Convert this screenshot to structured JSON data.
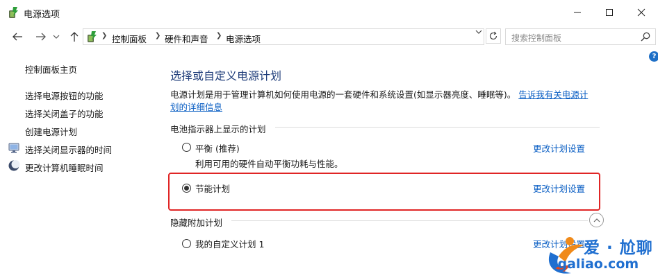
{
  "window": {
    "title": "电源选项",
    "min_icon": "minimize-icon",
    "max_icon": "maximize-icon",
    "close_icon": "close-icon"
  },
  "address_bar": {
    "breadcrumbs": [
      "控制面板",
      "硬件和声音",
      "电源选项"
    ],
    "search_placeholder": "搜索控制面板"
  },
  "sidebar": {
    "items": [
      {
        "label": "控制面板主页"
      },
      {
        "label": "选择电源按钮的功能"
      },
      {
        "label": "选择关闭盖子的功能"
      },
      {
        "label": "创建电源计划"
      },
      {
        "label": "选择关闭显示器的时间",
        "icon": "monitor-power-icon"
      },
      {
        "label": "更改计算机睡眠时间",
        "icon": "moon-sleep-icon"
      }
    ]
  },
  "main": {
    "title": "选择或自定义电源计划",
    "description": "电源计划是用于管理计算机如何使用电源的一套硬件和系统设置(如显示器亮度、睡眠等)。",
    "description_link_1": "告诉我有关电源计",
    "description_link_2": "划的详细信息",
    "battery_group_title": "电池指示器上显示的计划",
    "plans": [
      {
        "name": "平衡 (推荐)",
        "desc": "利用可用的硬件自动平衡功耗与性能。",
        "checked": false,
        "link": "更改计划设置"
      },
      {
        "name": "节能计划",
        "desc": "",
        "checked": true,
        "link": "更改计划设置"
      }
    ],
    "hidden_group_title": "隐藏附加计划",
    "hidden_plans": [
      {
        "name": "我的自定义计划 1",
        "checked": false,
        "link": "更改计划设置"
      }
    ]
  },
  "watermark": {
    "top": "爱 · 尬聊",
    "bottom": "igaliao.com"
  },
  "colors": {
    "link": "#0b5fc4",
    "title": "#1f3d7a",
    "highlight": "#e02525",
    "watermark": "#1f6fd0"
  }
}
